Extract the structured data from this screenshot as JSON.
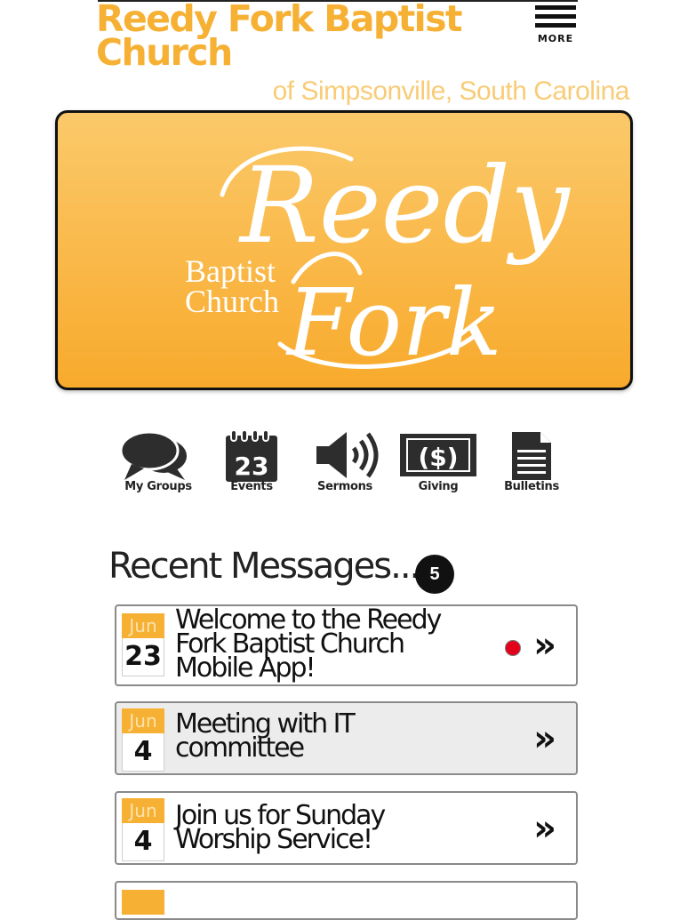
{
  "header": {
    "title": "Reedy Fork Baptist Church",
    "subtitle": "of Simpsonville, South Carolina",
    "more_label": "MORE"
  },
  "banner": {
    "logo_word_1": "Reedy",
    "logo_word_2": "Fork",
    "logo_small_1": "Baptist",
    "logo_small_2": "Church",
    "colors": {
      "top": "#fbc96a",
      "bottom": "#f8aa2c",
      "text": "#ffffff"
    }
  },
  "nav": [
    {
      "label": "My Groups",
      "icon": "chat-bubbles-icon"
    },
    {
      "label": "Events",
      "icon": "calendar-icon",
      "calendar_day": "23"
    },
    {
      "label": "Sermons",
      "icon": "speaker-icon"
    },
    {
      "label": "Giving",
      "icon": "dollar-bill-icon",
      "symbol": "($)"
    },
    {
      "label": "Bulletins",
      "icon": "document-icon"
    }
  ],
  "recent": {
    "title": "Recent Messages...",
    "count": "5",
    "chevron": "»",
    "messages": [
      {
        "month": "Jun",
        "day": "23",
        "title": "Welcome to the Reedy Fork Baptist Church Mobile App!",
        "unread": true
      },
      {
        "month": "Jun",
        "day": "4",
        "title": "Meeting with IT committee",
        "unread": false
      },
      {
        "month": "Jun",
        "day": "4",
        "title": "Join us for Sunday Worship Service!",
        "unread": false
      }
    ]
  },
  "colors": {
    "accent": "#f6b033",
    "subtitle": "#f8cc77",
    "unread_dot": "#e3001b"
  }
}
